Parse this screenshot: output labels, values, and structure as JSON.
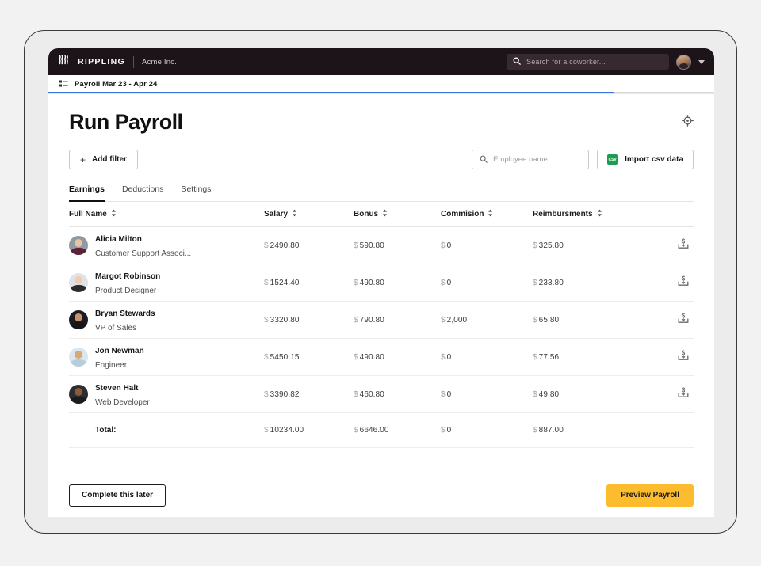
{
  "topnav": {
    "logo_icon": "rippling-logo-icon",
    "logo_text": "RIPPLING",
    "company": "Acme Inc.",
    "search_icon": "search-icon",
    "search_placeholder": "Search for a coworker...",
    "avatar_icon": "user-avatar",
    "chevron_icon": "chevron-down-icon",
    "bg_color": "#1c1418"
  },
  "breadcrumb": {
    "icon": "list-icon",
    "label": "Payroll Mar 23 - Apr 24",
    "progress_percent": 85,
    "progress_color": "#3b76d8"
  },
  "page": {
    "title": "Run Payroll",
    "gear_icon": "gear-icon"
  },
  "toolbar": {
    "add_filter_label": "Add filter",
    "plus_icon": "plus-icon",
    "search_icon": "search-icon",
    "search_placeholder": "Employee name",
    "search_value": "",
    "csv_badge_text": "CSV",
    "csv_icon": "csv-file-icon",
    "import_label": "Import csv data",
    "csv_badge_color": "#1d9d4f"
  },
  "tabs": [
    {
      "label": "Earnings",
      "active": true
    },
    {
      "label": "Deductions",
      "active": false
    },
    {
      "label": "Settings",
      "active": false
    }
  ],
  "table": {
    "columns": [
      {
        "label": "Full Name",
        "sort_icon": "sort-icon"
      },
      {
        "label": "Salary",
        "sort_icon": "sort-icon"
      },
      {
        "label": "Bonus",
        "sort_icon": "sort-icon"
      },
      {
        "label": "Commision",
        "sort_icon": "sort-icon"
      },
      {
        "label": "Reimbursments",
        "sort_icon": "sort-icon"
      }
    ],
    "row_action_icon": "deposit-money-icon",
    "rows": [
      {
        "name": "Alicia Milton",
        "role": "Customer Support Associ...",
        "salary": "2490.80",
        "bonus": "590.80",
        "commission": "0",
        "reimbursement": "325.80",
        "avatar_bg": "#8f9aa2",
        "avatar_skin": "#e8c3a4",
        "avatar_body": "#5c2237"
      },
      {
        "name": "Margot Robinson",
        "role": "Product Designer",
        "salary": "1524.40",
        "bonus": "490.80",
        "commission": "0",
        "reimbursement": "233.80",
        "avatar_bg": "#dfe3e6",
        "avatar_skin": "#f0cdb0",
        "avatar_body": "#2b2b2f"
      },
      {
        "name": "Bryan Stewards",
        "role": "VP of Sales",
        "salary": "3320.80",
        "bonus": "790.80",
        "commission": "2,000",
        "reimbursement": "65.80",
        "avatar_bg": "#1b1b20",
        "avatar_skin": "#c9936b",
        "avatar_body": "#15151a"
      },
      {
        "name": "Jon Newman",
        "role": "Engineer",
        "salary": "5450.15",
        "bonus": "490.80",
        "commission": "0",
        "reimbursement": "77.56",
        "avatar_bg": "#dbe6ee",
        "avatar_skin": "#d8a878",
        "avatar_body": "#b8cddb"
      },
      {
        "name": "Steven Halt",
        "role": "Web Developer",
        "salary": "3390.82",
        "bonus": "460.80",
        "commission": "0",
        "reimbursement": "49.80",
        "avatar_bg": "#2c2c31",
        "avatar_skin": "#8a5a3a",
        "avatar_body": "#1a1a1f"
      }
    ],
    "total": {
      "label": "Total:",
      "salary": "10234.00",
      "bonus": "6646.00",
      "commission": "0",
      "reimbursement": "887.00"
    },
    "currency_symbol": "$"
  },
  "footer": {
    "later_label": "Complete this later",
    "preview_label": "Preview Payroll",
    "preview_color": "#fcbc2e"
  }
}
